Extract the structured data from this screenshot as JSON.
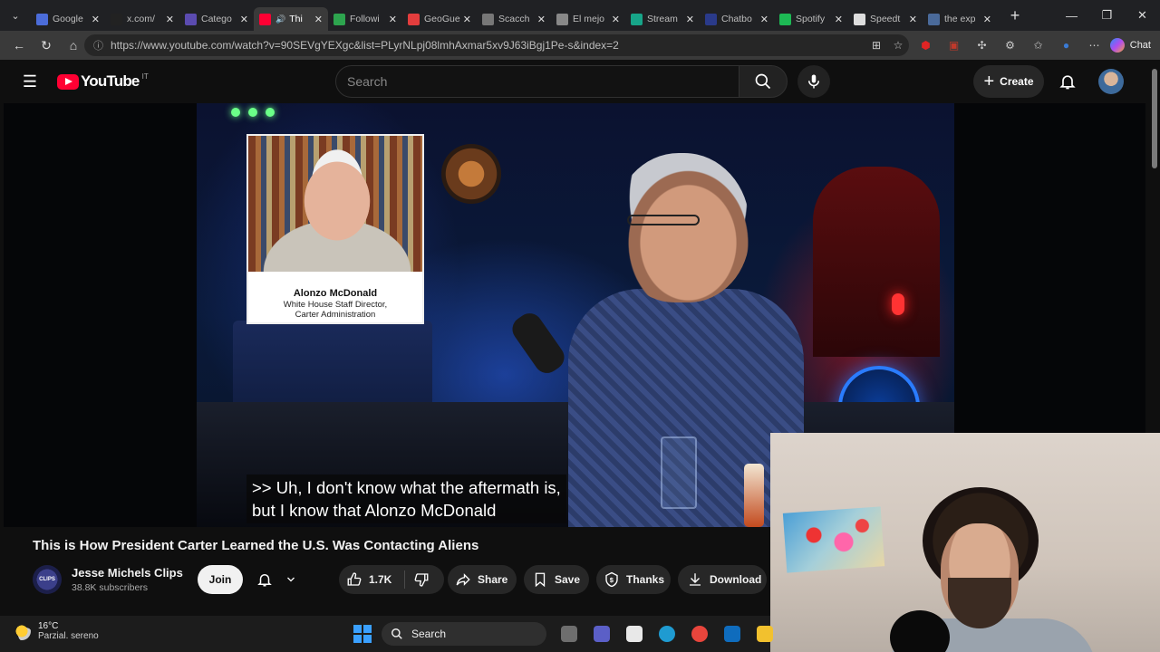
{
  "browser": {
    "tabs": [
      {
        "title": "Google",
        "color": "#4b6cd9",
        "active": false
      },
      {
        "title": "x.com/",
        "color": "#222222",
        "active": false
      },
      {
        "title": "Catego",
        "color": "#5b4bb0",
        "active": false
      },
      {
        "title": "Thi",
        "color": "#ff0033",
        "active": true
      },
      {
        "title": "Followi",
        "color": "#2da44e",
        "active": false
      },
      {
        "title": "GeoGue",
        "color": "#e33d3d",
        "active": false
      },
      {
        "title": "Scacch",
        "color": "#777777",
        "active": false
      },
      {
        "title": "El mejo",
        "color": "#888888",
        "active": false
      },
      {
        "title": "Stream",
        "color": "#17a589",
        "active": false
      },
      {
        "title": "Chatbo",
        "color": "#2a3a8a",
        "active": false
      },
      {
        "title": "Spotify",
        "color": "#1db954",
        "active": false
      },
      {
        "title": "Speedt",
        "color": "#dddddd",
        "active": false
      },
      {
        "title": "the exp",
        "color": "#4a6a9a",
        "active": false
      }
    ],
    "url": "https://www.youtube.com/watch?v=90SEVgYEXgc&list=PLyrNLpj08lmhAxmar5xv9J63iBgj1Pe-s&index=2",
    "chat_label": "Chat"
  },
  "youtube": {
    "logo_text": "YouTube",
    "country_code": "IT",
    "search_placeholder": "Search",
    "create_label": "Create"
  },
  "video": {
    "inset_name": "Alonzo McDonald",
    "inset_role_1": "White House Staff Director,",
    "inset_role_2": "Carter Administration",
    "subtitle_line1": ">> Uh, I don't know what the aftermath is,",
    "subtitle_line2": "but I know that Alonzo McDonald"
  },
  "info": {
    "title": "This is How President Carter Learned the U.S. Was Contacting Aliens",
    "channel_avatar_text": "CLIPS",
    "channel_name": "Jesse Michels Clips",
    "subscribers": "38.8K subscribers",
    "join_label": "Join",
    "likes": "1.7K",
    "share_label": "Share",
    "save_label": "Save",
    "thanks_label": "Thanks",
    "download_label": "Download"
  },
  "taskbar": {
    "temperature": "16°C",
    "condition": "Parzial. sereno",
    "search_label": "Search",
    "apps": [
      {
        "name": "file-explorer-icon",
        "color": "#6e6e6e"
      },
      {
        "name": "teams-icon",
        "color": "#5b5fc7"
      },
      {
        "name": "store-icon",
        "color": "#e8e8e8"
      },
      {
        "name": "edge-icon",
        "color": "#1f9bd1"
      },
      {
        "name": "chrome-icon",
        "color": "#e8453c"
      },
      {
        "name": "outlook-icon",
        "color": "#0f6cbd"
      },
      {
        "name": "folder-icon",
        "color": "#f2c12e"
      }
    ]
  }
}
